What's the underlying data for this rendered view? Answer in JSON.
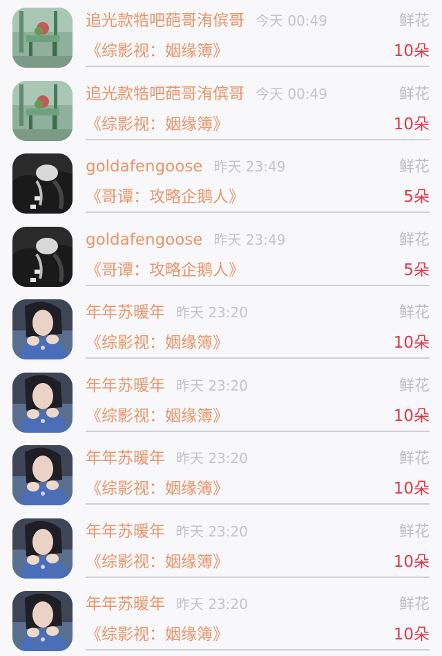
{
  "items": [
    {
      "name": "追光款牿吧葩哥洧傧哥",
      "time": "今天 00:49",
      "gift": "鲜花",
      "book": "《综影视：姻缘簿》",
      "count": "10朵",
      "avatar_icon": "garden-chair-photo"
    },
    {
      "name": "追光款牿吧葩哥洧傧哥",
      "time": "今天 00:49",
      "gift": "鲜花",
      "book": "《综影视：姻缘簿》",
      "count": "10朵",
      "avatar_icon": "garden-chair-photo"
    },
    {
      "name": "goldafengoose",
      "time": "昨天 23:49",
      "gift": "鲜花",
      "book": "《哥谭：攻略企鹅人》",
      "count": "5朵",
      "avatar_icon": "dark-figure-photo"
    },
    {
      "name": "goldafengoose",
      "time": "昨天 23:49",
      "gift": "鲜花",
      "book": "《哥谭：攻略企鹅人》",
      "count": "5朵",
      "avatar_icon": "dark-figure-photo"
    },
    {
      "name": "年年苏暖年",
      "time": "昨天 23:20",
      "gift": "鲜花",
      "book": "《综影视：姻缘簿》",
      "count": "10朵",
      "avatar_icon": "woman-portrait-photo"
    },
    {
      "name": "年年苏暖年",
      "time": "昨天 23:20",
      "gift": "鲜花",
      "book": "《综影视：姻缘簿》",
      "count": "10朵",
      "avatar_icon": "woman-portrait-photo"
    },
    {
      "name": "年年苏暖年",
      "time": "昨天 23:20",
      "gift": "鲜花",
      "book": "《综影视：姻缘簿》",
      "count": "10朵",
      "avatar_icon": "woman-portrait-photo"
    },
    {
      "name": "年年苏暖年",
      "time": "昨天 23:20",
      "gift": "鲜花",
      "book": "《综影视：姻缘簿》",
      "count": "10朵",
      "avatar_icon": "woman-portrait-photo"
    },
    {
      "name": "年年苏暖年",
      "time": "昨天 23:20",
      "gift": "鲜花",
      "book": "《综影视：姻缘簿》",
      "count": "10朵",
      "avatar_icon": "woman-portrait-photo"
    }
  ],
  "colors": {
    "name": "#e8956a",
    "time": "#c4c4c8",
    "gift": "#bdbdc2",
    "count": "#e0374d",
    "background": "#f8f7f9"
  }
}
